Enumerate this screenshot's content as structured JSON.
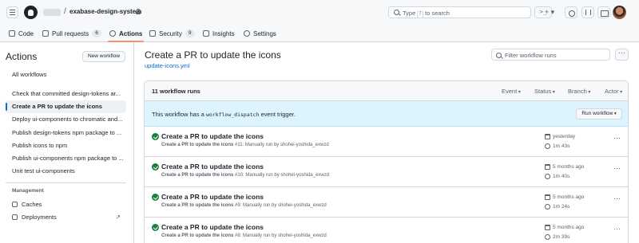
{
  "header": {
    "repo_name": "exabase-design-system",
    "separator": "/",
    "search_placeholder": "Type / to search",
    "search_prefix": "Type",
    "search_key": "/",
    "search_suffix": "to search",
    "command_label": ">_",
    "plus_label": "+ ▾"
  },
  "repo_nav": {
    "tabs": [
      {
        "label": "Code",
        "icon": "code-icon"
      },
      {
        "label": "Pull requests",
        "icon": "git-pull-request-icon",
        "count": "6"
      },
      {
        "label": "Actions",
        "icon": "play-icon",
        "selected": true
      },
      {
        "label": "Security",
        "icon": "shield-icon",
        "count": "9"
      },
      {
        "label": "Insights",
        "icon": "graph-icon"
      },
      {
        "label": "Settings",
        "icon": "gear-icon"
      }
    ]
  },
  "sidebar": {
    "title": "Actions",
    "new_workflow": "New workflow",
    "all_workflows": "All workflows",
    "workflows": [
      "Check that committed design-tokens ar...",
      "Create a PR to update the icons",
      "Deploy ui-components to chromatic and...",
      "Publish design-tokens npm package to ...",
      "Publish icons to npm",
      "Publish ui-components npm package to ...",
      "Unit test ui-components"
    ],
    "management_label": "Management",
    "management_items": [
      "Caches",
      "Deployments"
    ]
  },
  "main": {
    "title": "Create a PR to update the icons",
    "file_link": "update-icons.yml",
    "filter_placeholder": "Filter workflow runs",
    "kebab": "···",
    "runs_count": "11 workflow runs",
    "filters": [
      "Event",
      "Status",
      "Branch",
      "Actor"
    ],
    "notice_prefix": "This workflow has a",
    "notice_code": "workflow_dispatch",
    "notice_suffix": "event trigger.",
    "run_workflow": "Run workflow",
    "runs": [
      {
        "title": "Create a PR to update the icons",
        "wf": "Create a PR to update the icons",
        "detail": "#11: Manually run by shohei-yoshida_exwzd",
        "date": "yesterday",
        "duration": "1m 43s"
      },
      {
        "title": "Create a PR to update the icons",
        "wf": "Create a PR to update the icons",
        "detail": "#10: Manually run by shohei-yoshida_exwzd",
        "date": "5 months ago",
        "duration": "1m 40s"
      },
      {
        "title": "Create a PR to update the icons",
        "wf": "Create a PR to update the icons",
        "detail": "#9: Manually run by shohei-yoshida_exwzd",
        "date": "5 months ago",
        "duration": "1m 24s"
      },
      {
        "title": "Create a PR to update the icons",
        "wf": "Create a PR to update the icons",
        "detail": "#8: Manually run by shohei-yoshida_exwzd",
        "date": "5 months ago",
        "duration": "2m 39s"
      }
    ]
  },
  "colors": {
    "accent": "#0969da",
    "success": "#1a7f37",
    "selected_underline": "#fd8c73",
    "notice_bg": "#ddf4ff"
  }
}
